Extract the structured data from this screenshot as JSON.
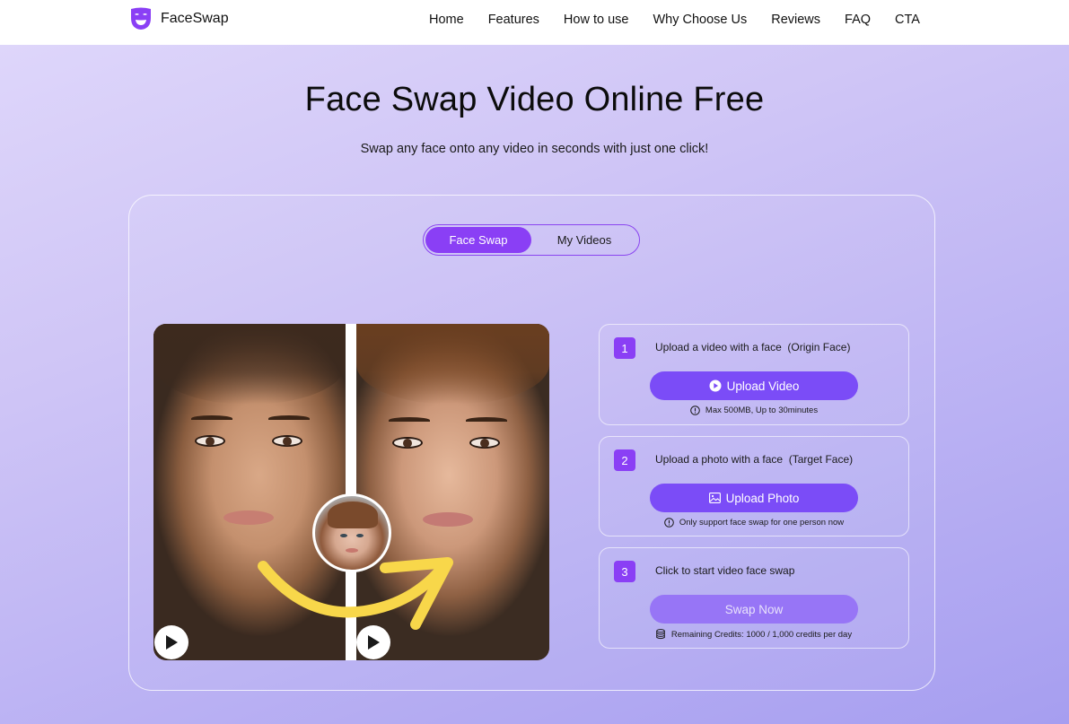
{
  "header": {
    "brand": "FaceSwap",
    "brand_color": "#8a3ff5",
    "nav": [
      "Home",
      "Features",
      "How to use",
      "Why Choose Us",
      "Reviews",
      "FAQ",
      "CTA"
    ]
  },
  "hero": {
    "title": "Face Swap Video Online Free",
    "subtitle": "Swap any face onto any video in seconds with just one click!"
  },
  "tabs": [
    {
      "label": "Face Swap",
      "active": true
    },
    {
      "label": "My Videos",
      "active": false
    }
  ],
  "preview": {
    "description": "Before/after face swap preview with target face thumbnail and curved arrow",
    "icons": [
      "play-icon",
      "play-icon"
    ]
  },
  "steps": [
    {
      "number": "1",
      "label": "Upload a video with a face  (Origin Face)",
      "button": "Upload Video",
      "button_icon": "play-circle-icon",
      "note_icon": "info-icon",
      "note": "Max 500MB, Up to 30minutes"
    },
    {
      "number": "2",
      "label": "Upload a photo with a face  (Target Face)",
      "button": "Upload Photo",
      "button_icon": "image-icon",
      "note_icon": "info-icon",
      "note": "Only support face swap for one person now"
    },
    {
      "number": "3",
      "label": "Click to start video face swap",
      "button": "Swap Now",
      "button_disabled": true,
      "note_icon": "database-icon",
      "note": "Remaining Credits:  1000 / 1,000 credits per day"
    }
  ],
  "colors": {
    "accent": "#8a3ff5",
    "button": "#7b4cf7",
    "button_disabled": "#9775f6",
    "arrow": "#f8d74a"
  }
}
